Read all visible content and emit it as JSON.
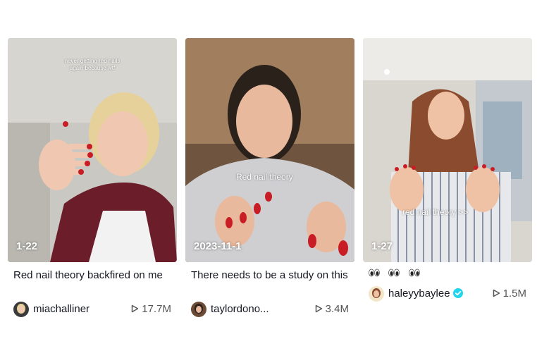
{
  "videos": [
    {
      "overlay_text": "never getting red nails\nagain because wtf",
      "date_label": "1-22",
      "caption": "Red nail theory backfired on me",
      "username": "miachalliner",
      "views": "17.7M"
    },
    {
      "overlay_text": "Red nail theory",
      "date_label": "2023-11-1",
      "caption": "There needs to be a study on this",
      "username": "taylordono...",
      "views": "3.4M"
    },
    {
      "overlay_text": "red nail theory >>",
      "date_label": "1-27",
      "caption_icons": [
        "eyes-emoji",
        "eyes-emoji",
        "eyes-emoji"
      ],
      "username": "haleyybaylee",
      "verified": true,
      "views": "1.5M"
    }
  ],
  "colors": {
    "verified_badge": "#20d5ec",
    "nail_red": "#c81d25"
  }
}
